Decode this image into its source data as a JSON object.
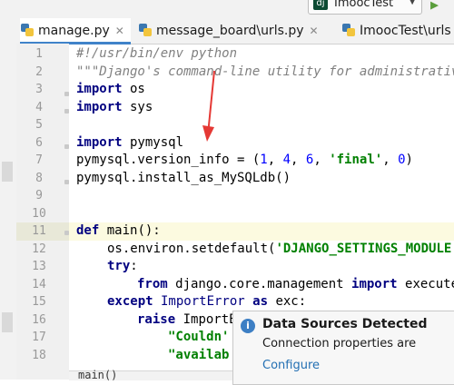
{
  "toolbar": {
    "run_config": "ImoocTest",
    "run_config_icon": "dj"
  },
  "tabs": [
    {
      "label": "manage.py",
      "active": true
    },
    {
      "label": "message_board\\urls.py",
      "active": false
    },
    {
      "label": "ImoocTest\\urls",
      "active": false
    }
  ],
  "lines": [
    "1",
    "2",
    "3",
    "4",
    "5",
    "6",
    "7",
    "8",
    "9",
    "10",
    "11",
    "12",
    "13",
    "14",
    "15",
    "16",
    "17",
    "18"
  ],
  "code": {
    "l1": "#!/usr/bin/env python",
    "l2": "\"\"\"Django's command-line utility for administrative",
    "l3_kw": "import",
    "l3_rest": " os",
    "l4_kw": "import",
    "l4_rest": " sys",
    "l6_kw": "import",
    "l6_rest": " pymysql",
    "l7_a": "pymysql.version_info = (",
    "l7_n1": "1",
    "l7_c1": ", ",
    "l7_n2": "4",
    "l7_c2": ", ",
    "l7_n3": "6",
    "l7_c3": ", ",
    "l7_s": "'final'",
    "l7_c4": ", ",
    "l7_n4": "0",
    "l7_b": ")",
    "l8": "pymysql.install_as_MySQLdb()",
    "l11_kw": "def",
    "l11_rest": " main():",
    "l12_a": "os.environ.setdefault(",
    "l12_s": "'DJANGO_SETTINGS_MODULE",
    "l13_kw": "try",
    "l13_rest": ":",
    "l14_kw1": "from",
    "l14_mid": " django.core.management ",
    "l14_kw2": "import",
    "l14_rest": " execute",
    "l15_kw1": "except",
    "l15_cls": " ImportError ",
    "l15_kw2": "as",
    "l15_rest": " exc:",
    "l16_kw": "raise",
    "l16_rest": " ImportE",
    "l17_s": "\"Couldn'",
    "l18_s": "\"availab",
    "l19": "main()"
  },
  "notification": {
    "title": "Data Sources Detected",
    "body": "Connection properties are",
    "link": "Configure",
    "icon": "info-icon"
  },
  "colors": {
    "keyword": "#000080",
    "string": "#008000",
    "comment": "#808080",
    "number": "#0000ff",
    "arrow": "#e53935",
    "tab_accent": "#4083c9"
  }
}
